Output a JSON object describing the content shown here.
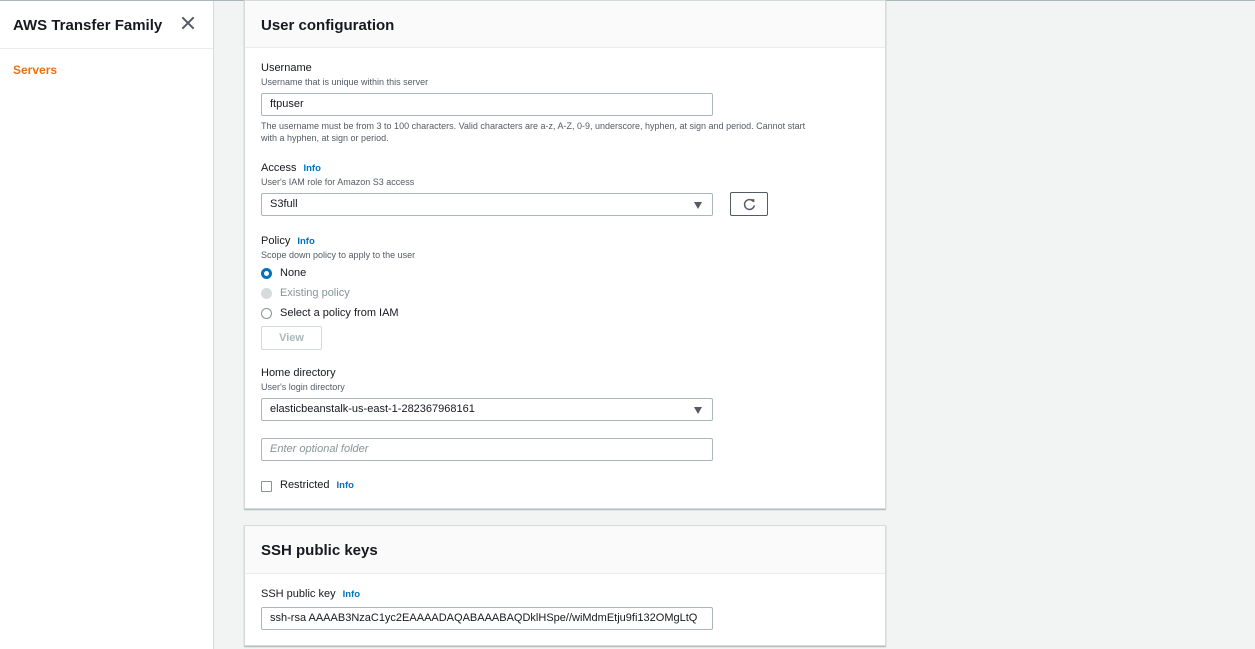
{
  "sidebar": {
    "title": "AWS Transfer Family",
    "items": [
      {
        "label": "Servers"
      }
    ]
  },
  "user_config": {
    "title": "User configuration",
    "username": {
      "label": "Username",
      "description": "Username that is unique within this server",
      "value": "ftpuser",
      "help_line1": "The username must be from 3 to 100 characters. Valid characters are a-z, A-Z, 0-9, underscore, hyphen, at sign and period. Cannot start",
      "help_line2": "with a hyphen, at sign or period."
    },
    "access": {
      "label": "Access",
      "info": "Info",
      "description": "User's IAM role for Amazon S3 access",
      "selected": "S3full"
    },
    "policy": {
      "label": "Policy",
      "info": "Info",
      "description": "Scope down policy to apply to the user",
      "options": [
        {
          "label": "None",
          "state": "checked"
        },
        {
          "label": "Existing policy",
          "state": "disabled"
        },
        {
          "label": "Select a policy from IAM",
          "state": "unchecked"
        }
      ],
      "view_button": "View"
    },
    "home_directory": {
      "label": "Home directory",
      "description": "User's login directory",
      "selected": "elasticbeanstalk-us-east-1-282367968161",
      "folder_placeholder": "Enter optional folder"
    },
    "restricted": {
      "label": "Restricted",
      "info": "Info",
      "checked": false
    }
  },
  "ssh_keys": {
    "title": "SSH public keys",
    "key_label": "SSH public key",
    "info": "Info",
    "key_value": "ssh-rsa AAAAB3NzaC1yc2EAAAADAQABAAABAQDklHSpe//wiMdmEtju9fi132OMgLtQ"
  },
  "icons": {
    "close": "close-icon",
    "refresh": "refresh-icon",
    "dropdown": "caret-down-icon"
  },
  "colors": {
    "accent_orange": "#ec7211",
    "link_blue": "#0073bb",
    "background": "#f2f3f3"
  }
}
